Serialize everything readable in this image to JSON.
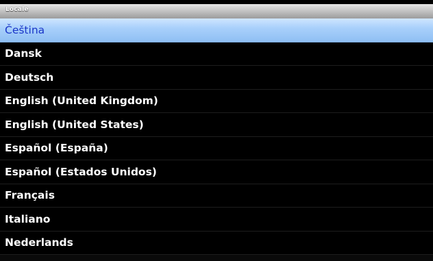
{
  "window": {
    "title": "Locale"
  },
  "locale_list": {
    "selected_index": 0,
    "items": [
      {
        "label": "Čeština"
      },
      {
        "label": "Dansk"
      },
      {
        "label": "Deutsch"
      },
      {
        "label": "English (United Kingdom)"
      },
      {
        "label": "English (United States)"
      },
      {
        "label": "Español (España)"
      },
      {
        "label": "Español (Estados Unidos)"
      },
      {
        "label": "Français"
      },
      {
        "label": "Italiano"
      },
      {
        "label": "Nederlands"
      }
    ]
  },
  "colors": {
    "background": "#000000",
    "item_text": "#ffffff",
    "selected_highlight": "#a9d0fb",
    "selected_text": "#1a36c8",
    "title_bar": "#bdbdbd"
  }
}
